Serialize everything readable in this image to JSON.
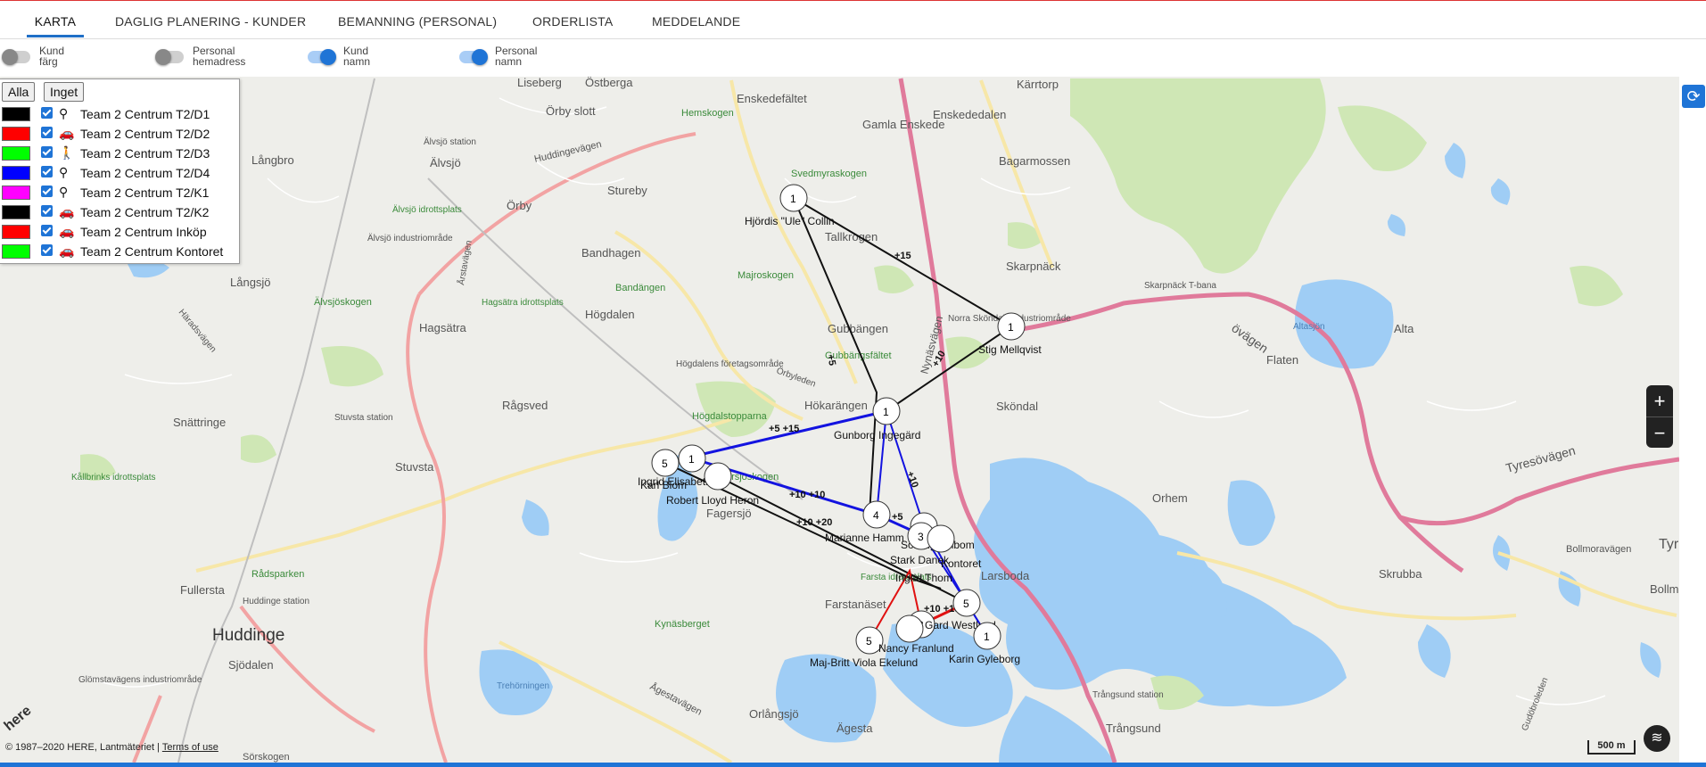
{
  "tabs": [
    {
      "label": "KARTA",
      "active": true
    },
    {
      "label": "DAGLIG PLANERING - KUNDER",
      "active": false
    },
    {
      "label": "BEMANNING (PERSONAL)",
      "active": false
    },
    {
      "label": "ORDERLISTA",
      "active": false
    },
    {
      "label": "MEDDELANDE",
      "active": false
    }
  ],
  "toggles": [
    {
      "label1": "Kund",
      "label2": "färg",
      "on": false
    },
    {
      "label1": "Personal",
      "label2": "hemadress",
      "on": false
    },
    {
      "label1": "Kund",
      "label2": "namn",
      "on": true
    },
    {
      "label1": "Personal",
      "label2": "namn",
      "on": true
    }
  ],
  "legend": {
    "all_label": "Alla",
    "none_label": "Inget",
    "teams": [
      {
        "name": "Team 2 Centrum T2/D1",
        "color": "#000000",
        "icon": "bicycle-icon",
        "glyph": "⚲",
        "checked": true
      },
      {
        "name": "Team 2 Centrum T2/D2",
        "color": "#ff0000",
        "icon": "car-icon",
        "glyph": "🚗",
        "checked": true
      },
      {
        "name": "Team 2 Centrum T2/D3",
        "color": "#00ff00",
        "icon": "walk-icon",
        "glyph": "🚶",
        "checked": true
      },
      {
        "name": "Team 2 Centrum T2/D4",
        "color": "#0000ff",
        "icon": "bicycle-icon",
        "glyph": "⚲",
        "checked": true
      },
      {
        "name": "Team 2 Centrum T2/K1",
        "color": "#ff00ff",
        "icon": "bicycle-icon",
        "glyph": "⚲",
        "checked": true
      },
      {
        "name": "Team 2 Centrum T2/K2",
        "color": "#000000",
        "icon": "car-icon",
        "glyph": "🚗",
        "checked": true
      },
      {
        "name": "Team 2 Centrum Inköp",
        "color": "#ff0000",
        "icon": "car-icon",
        "glyph": "🚗",
        "checked": true
      },
      {
        "name": "Team 2 Centrum Kontoret",
        "color": "#00ff00",
        "icon": "car-icon",
        "glyph": "🚗",
        "checked": true
      }
    ]
  },
  "places": [
    "Liseberg",
    "Östberga",
    "Enskedefältet",
    "Gamla Enskede",
    "Enskededalen",
    "Kärrtorp",
    "Hemskogen",
    "Örby slott",
    "Älvsjö station",
    "Långbro",
    "Älvsjö",
    "Huddingevägen",
    "Svedmyraskogen",
    "Bagarmossen",
    "Älvsjö idrottsplats",
    "Örby",
    "Stureby",
    "Älvsjö industriområde",
    "Bandhagen",
    "Tallkrogen",
    "Skarpnäck",
    "Skarpnäck T-bana",
    "Majroskogen",
    "Bandängen",
    "Långsjö",
    "Älvsjöskogen",
    "Hagsätra idrottsplats",
    "Hagsätra",
    "Högdalen",
    "Gubbängen",
    "Norra Sköndals industriområde",
    "Altasjön",
    "Alta",
    "Flaten",
    "Gubbängsfältet",
    "Högdalens företagsområde",
    "Örbyleden",
    "Snättringe",
    "Stuvsta station",
    "Rågsved",
    "Högdalstopparna",
    "Hökarängen",
    "Sköndal",
    "Nynäsvägen",
    "Kållbrinks idrottsplats",
    "Stuvsta",
    "Fagersjöskogen",
    "Fagersjö",
    "Orhem",
    "Tyresövägen",
    "Larsboda",
    "Farsta idrottsplats",
    "Skrubba",
    "Bollmoravägen",
    "Tyr",
    "Bollm",
    "Fullersta",
    "Rådsparken",
    "Huddinge station",
    "Farstanäset",
    "Kynäsberget",
    "Huddinge",
    "Sjödalen",
    "Glömstavägens industriområde",
    "Trehörningen",
    "Ågestavägen",
    "Trångsund station",
    "Trångsund",
    "Orlångsjö",
    "Ägesta",
    "Sörskogen",
    "Gudöbroleden",
    "Häradsvägen",
    "Årstavägen",
    "övägen"
  ],
  "route_labels": [
    "+15",
    "+10",
    "+5",
    "+5 +15",
    "+10 +10",
    "+10 +20",
    "+5",
    "+10",
    "+10 +15"
  ],
  "markers": [
    {
      "n": "1",
      "label": "Hjördis \"Ule\" Collin"
    },
    {
      "n": "1",
      "label": "Stig Mellqvist"
    },
    {
      "n": "1",
      "label": "Gunborg Ingegärd"
    },
    {
      "n": "5",
      "label": "Karl Blom"
    },
    {
      "n": "1",
      "label": "Ingrid Elisabeth H"
    },
    {
      "n": "",
      "label": "Robert Lloyd Heron"
    },
    {
      "n": "4",
      "label": "Marianne Hamm"
    },
    {
      "n": "1",
      "label": "Solveig Ahlbom"
    },
    {
      "n": "3",
      "label": "Stark Danek"
    },
    {
      "n": "",
      "label": "Kontoret"
    },
    {
      "n": "5",
      "label": "Ingrid Thom"
    },
    {
      "n": "3",
      "label": "Gard Westlund"
    },
    {
      "n": "5",
      "label": "Maj-Britt Viola Ekelund"
    },
    {
      "n": "",
      "label": "Nancy Franlund"
    },
    {
      "n": "1",
      "label": "Karin Gyleborg"
    }
  ],
  "map_controls": {
    "zoom_in": "+",
    "zoom_out": "−",
    "refresh": "⟳",
    "layers": "≋",
    "scale": "500 m"
  },
  "copyright": {
    "text": "© 1987–2020 HERE, Lantmäteriet | ",
    "link": "Terms of use"
  }
}
